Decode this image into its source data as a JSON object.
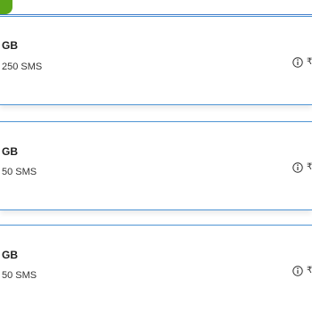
{
  "cards": [
    {
      "data_amount": "GB",
      "sms_amount": "250 SMS",
      "price_fragment": "₹"
    },
    {
      "data_amount": "GB",
      "sms_amount": "50 SMS",
      "price_fragment": "₹"
    },
    {
      "data_amount": "GB",
      "sms_amount": "50 SMS",
      "price_fragment": "₹"
    }
  ],
  "icons": {
    "info": "info-icon"
  },
  "colors": {
    "accent_green": "#5aa61a",
    "divider_blue": "#4f94d4",
    "tab_blue": "#3a78c9"
  }
}
